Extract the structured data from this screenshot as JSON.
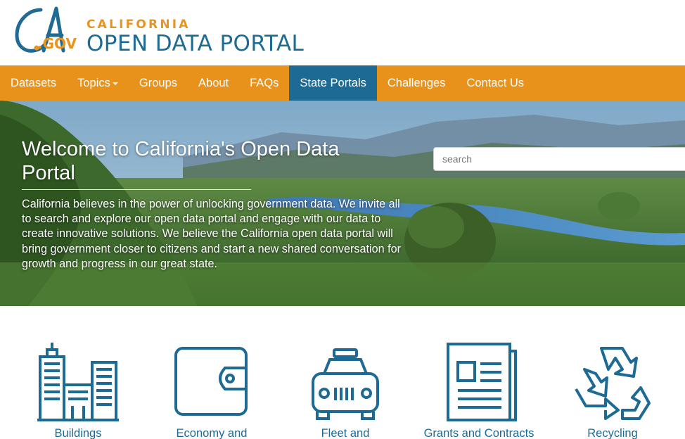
{
  "header": {
    "logo_ca": "CA",
    "logo_gov": ".GOV",
    "logo_small": "CALIFORNIA",
    "logo_big": "OPEN DATA PORTAL"
  },
  "nav": {
    "items": [
      {
        "label": "Datasets"
      },
      {
        "label": "Topics",
        "has_caret": true
      },
      {
        "label": "Groups"
      },
      {
        "label": "About"
      },
      {
        "label": "FAQs"
      },
      {
        "label": "State Portals",
        "active": true
      },
      {
        "label": "Challenges"
      },
      {
        "label": "Contact Us"
      }
    ]
  },
  "hero": {
    "title": "Welcome to California's Open Data Portal",
    "text": "California believes in the power of unlocking government data. We invite all to search and explore our open data portal and engage with our data to create innovative solutions. We believe the California open data portal will bring government closer to citizens and start a new shared conversation for growth and progress in our great state.",
    "search_placeholder": "search"
  },
  "topics": [
    {
      "label": "Buildings",
      "icon": "buildings-icon"
    },
    {
      "label": "Economy and",
      "icon": "wallet-icon"
    },
    {
      "label": "Fleet and",
      "icon": "car-icon"
    },
    {
      "label": "Grants and Contracts",
      "icon": "newspaper-icon"
    },
    {
      "label": "Recycling",
      "icon": "recycle-icon"
    }
  ],
  "colors": {
    "orange": "#e8921c",
    "blue": "#1d6a95",
    "icon_blue": "#1d6a95"
  }
}
